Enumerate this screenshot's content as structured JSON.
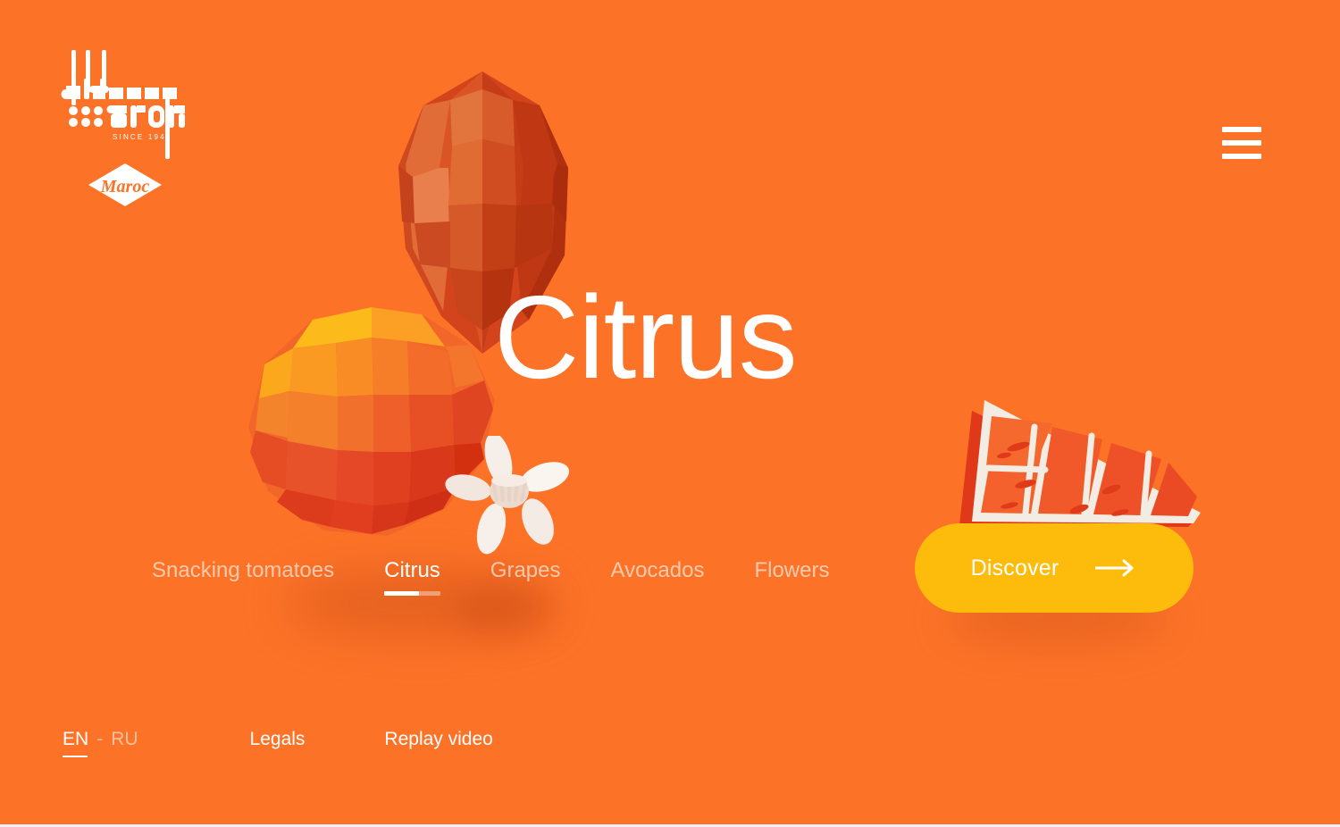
{
  "theme": {
    "background": "#fc7328",
    "accent_yellow": "#fdbb0c",
    "text_white": "#ffffff"
  },
  "brand": {
    "name": "delassus group",
    "name_line1": "delassus",
    "name_line2": "group",
    "tagline": "SINCE 1949",
    "badge_text": "Maroc",
    "logo_icon": "delassus-group-logo",
    "badge_icon": "maroc-diamond-badge"
  },
  "header": {
    "menu_icon": "hamburger-menu-icon"
  },
  "hero": {
    "title": "Citrus",
    "artwork": {
      "back_orange_icon": "low-poly-orange-dark",
      "front_orange_icon": "low-poly-orange-bright",
      "blossom_icon": "orange-blossom-flower",
      "slice_icon": "citrus-slice-wedge"
    }
  },
  "categories": {
    "items": [
      {
        "label": "Snacking tomatoes",
        "active": false
      },
      {
        "label": "Citrus",
        "active": true,
        "progress": 62
      },
      {
        "label": "Grapes",
        "active": false
      },
      {
        "label": "Avocados",
        "active": false
      },
      {
        "label": "Flowers",
        "active": false
      }
    ]
  },
  "cta": {
    "label": "Discover",
    "arrow_icon": "arrow-right-icon"
  },
  "footer": {
    "languages": [
      {
        "code": "EN",
        "active": true
      },
      {
        "code": "RU",
        "active": false
      }
    ],
    "separator": "-",
    "legals_label": "Legals",
    "replay_label": "Replay video"
  }
}
